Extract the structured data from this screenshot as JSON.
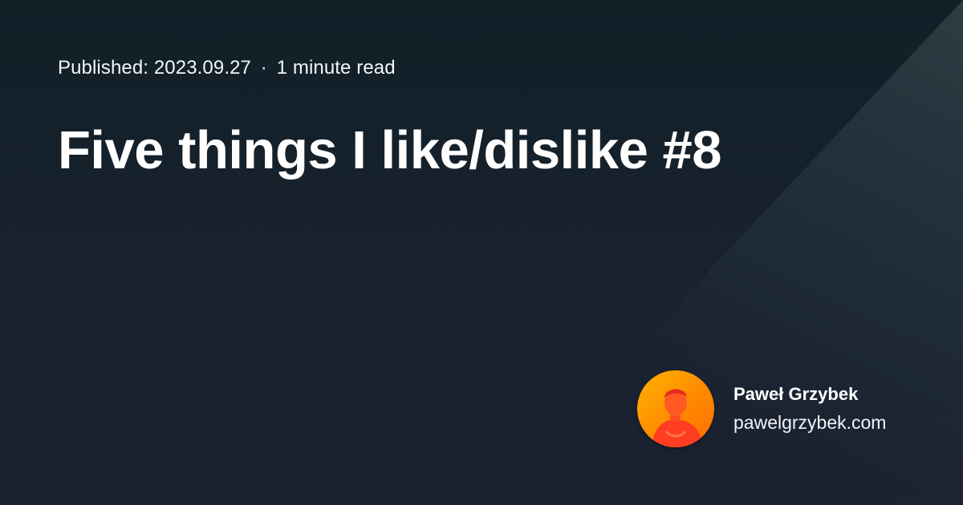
{
  "post": {
    "published_label": "Published:",
    "published_date": "2023.09.27",
    "separator": "·",
    "read_time": "1 minute read",
    "title": "Five things I like/dislike #8"
  },
  "author": {
    "name": "Paweł Grzybek",
    "website": "pawelgrzybek.com"
  },
  "colors": {
    "background_top": "#111f27",
    "background_bottom": "#1b2232",
    "diagonal_highlight": "#2d3f45",
    "avatar_orange": "#ff8a00",
    "avatar_red": "#ff3d22"
  },
  "icons": {
    "avatar": "author-portrait"
  }
}
